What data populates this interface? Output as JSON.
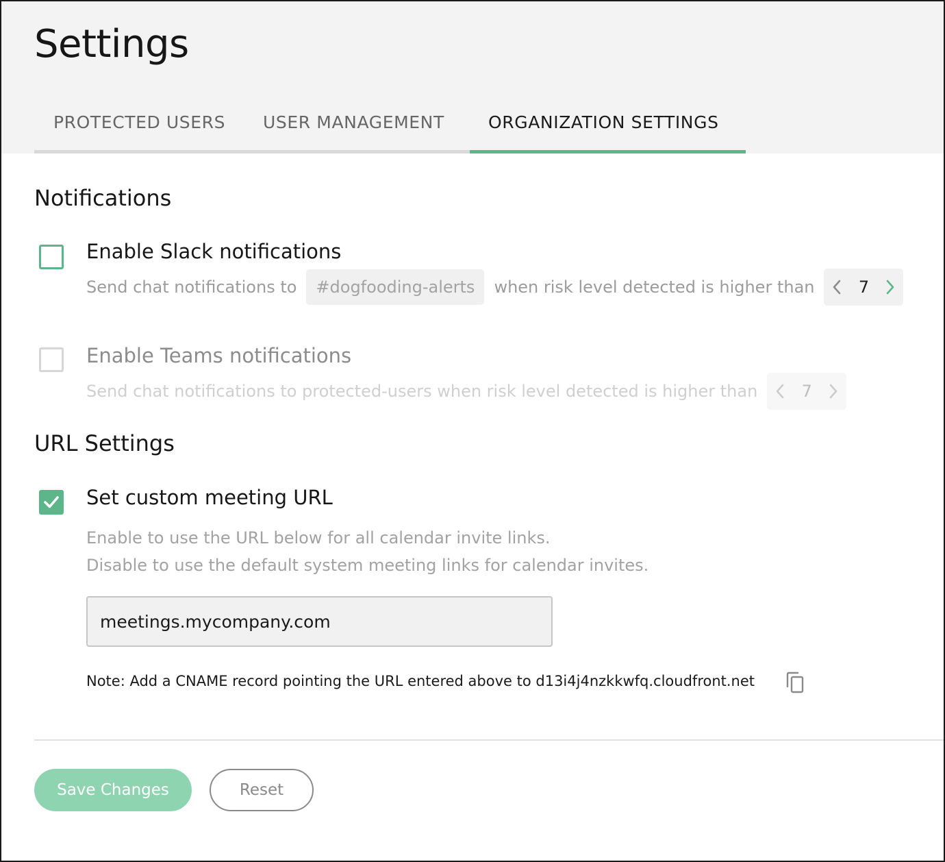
{
  "page": {
    "title": "Settings"
  },
  "tabs": [
    {
      "label": "PROTECTED USERS",
      "active": false
    },
    {
      "label": "USER MANAGEMENT",
      "active": false
    },
    {
      "label": "ORGANIZATION SETTINGS",
      "active": true
    }
  ],
  "notifications": {
    "title": "Notifications",
    "slack": {
      "label": "Enable Slack notifications",
      "checked": false,
      "prefix": "Send chat notifications to",
      "channel": "#dogfooding-alerts",
      "suffix": "when risk level detected is higher than",
      "risk_level": "7"
    },
    "teams": {
      "label": "Enable Teams notifications",
      "checked": false,
      "disabled": true,
      "text": "Send chat notifications to protected-users when risk level detected is higher than",
      "risk_level": "7"
    }
  },
  "url_settings": {
    "title": "URL Settings",
    "custom_url": {
      "label": "Set custom meeting URL",
      "checked": true,
      "desc_line1": "Enable to use the URL below for all calendar invite links.",
      "desc_line2": "Disable to use the default system meeting links for calendar invites.",
      "value": "meetings.mycompany.com",
      "note": "Note: Add a CNAME record pointing the URL entered above to d13i4j4nzkkwfq.cloudfront.net"
    }
  },
  "actions": {
    "save_label": "Save Changes",
    "reset_label": "Reset"
  },
  "colors": {
    "accent": "#5db58a",
    "save_button": "#8fd4b1",
    "header_bg": "#f3f3f3"
  },
  "icons": {
    "stepper_prev": "chevron-left-icon",
    "stepper_next": "chevron-right-icon",
    "checkmark": "check-icon",
    "copy": "copy-icon"
  }
}
